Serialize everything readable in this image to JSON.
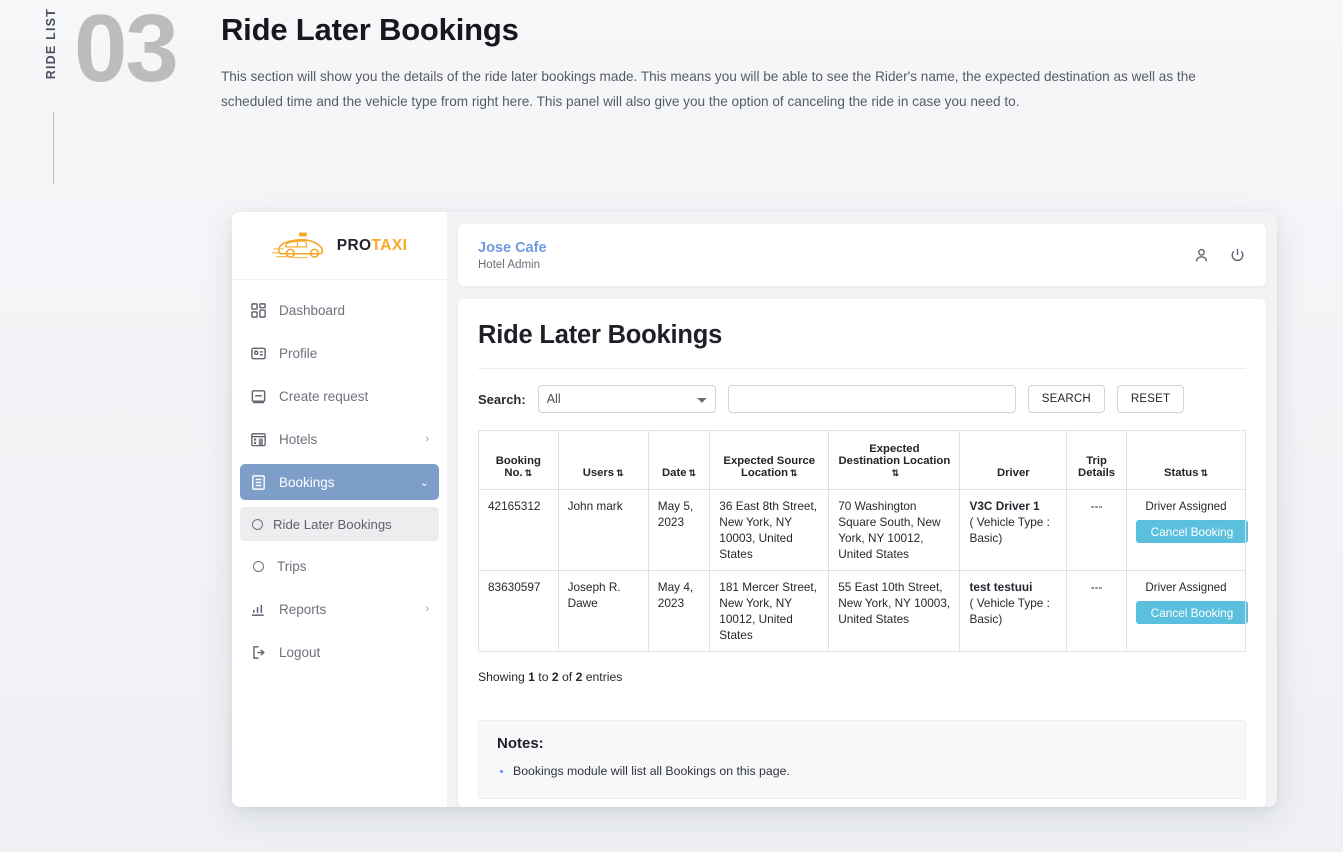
{
  "doc": {
    "section_label": "RIDE LIST",
    "number": "03",
    "title": "Ride Later Bookings",
    "description": "This section will show you the details of the ride later bookings made. This means you will be able to see the Rider's name, the expected destination as well as the scheduled time and the vehicle type from right here. This panel will also give you the option of canceling the ride in case you need to."
  },
  "sidebar": {
    "logo": {
      "pro": "PRO",
      "taxi": "TAXI",
      "icon": "taxi-car-icon"
    },
    "items": [
      {
        "label": "Dashboard",
        "icon": "dashboard-grid-icon",
        "active": false,
        "caret": ""
      },
      {
        "label": "Profile",
        "icon": "profile-card-icon",
        "active": false,
        "caret": ""
      },
      {
        "label": "Create request",
        "icon": "window-icon",
        "active": false,
        "caret": ""
      },
      {
        "label": "Hotels",
        "icon": "building-icon",
        "active": false,
        "caret": "›"
      },
      {
        "label": "Bookings",
        "icon": "list-doc-icon",
        "active": true,
        "caret": "⌄"
      }
    ],
    "sub_item": {
      "label": "Ride Later Bookings",
      "icon": "circle-outline-icon"
    },
    "items_after": [
      {
        "label": "Trips",
        "icon": "circle-outline-icon",
        "caret": ""
      },
      {
        "label": "Reports",
        "icon": "bar-chart-icon",
        "caret": "›"
      },
      {
        "label": "Logout",
        "icon": "logout-icon",
        "caret": ""
      }
    ]
  },
  "topbar": {
    "user_name": "Jose Cafe",
    "user_role": "Hotel Admin",
    "person_icon": "person-icon",
    "power_icon": "power-icon"
  },
  "page": {
    "title": "Ride Later Bookings",
    "search": {
      "label": "Search:",
      "select_value": "All",
      "select_options": [
        "All"
      ],
      "input_value": "",
      "input_placeholder": "",
      "search_button": "SEARCH",
      "reset_button": "RESET"
    },
    "table": {
      "columns": [
        {
          "label": "Booking No.",
          "sortable": true,
          "align": "left"
        },
        {
          "label": "Users",
          "sortable": true,
          "align": "left"
        },
        {
          "label": "Date",
          "sortable": true,
          "align": "left"
        },
        {
          "label": "Expected Source Location",
          "sortable": true,
          "align": "left"
        },
        {
          "label": "Expected Destination Location",
          "sortable": true,
          "align": "left"
        },
        {
          "label": "Driver",
          "sortable": false,
          "align": "left"
        },
        {
          "label": "Trip Details",
          "sortable": false,
          "align": "center"
        },
        {
          "label": "Status",
          "sortable": true,
          "align": "center"
        }
      ],
      "rows": [
        {
          "booking_no": "42165312",
          "user": "John mark",
          "date": "May 5, 2023",
          "source": "36 East 8th Street, New York, NY 10003, United States",
          "destination": "70 Washington Square South, New York, NY 10012, United States",
          "driver_name": "V3C Driver 1",
          "driver_type": "( Vehicle Type : Basic)",
          "trip_details": "---",
          "status_text": "Driver Assigned",
          "status_button": "Cancel Booking"
        },
        {
          "booking_no": "83630597",
          "user": "Joseph R. Dawe",
          "date": "May 4, 2023",
          "source": "181 Mercer Street, New York, NY 10012, United States",
          "destination": "55 East 10th Street, New York, NY 10003, United States",
          "driver_name": "test testuui",
          "driver_type": "( Vehicle Type : Basic)",
          "trip_details": "---",
          "status_text": "Driver Assigned",
          "status_button": "Cancel Booking"
        }
      ]
    },
    "showing": {
      "prefix": "Showing ",
      "from": "1",
      "mid": " to ",
      "to": "2",
      "mid2": " of ",
      "total": "2",
      "suffix": " entries"
    },
    "notes": {
      "title": "Notes:",
      "items": [
        "Bookings module will list all Bookings on this page."
      ]
    }
  },
  "colors": {
    "accent_blue": "#7c9ec9",
    "cancel_btn": "#5bc0de",
    "logo_orange": "#f7a928",
    "user_name_blue": "#6f9ae0"
  }
}
